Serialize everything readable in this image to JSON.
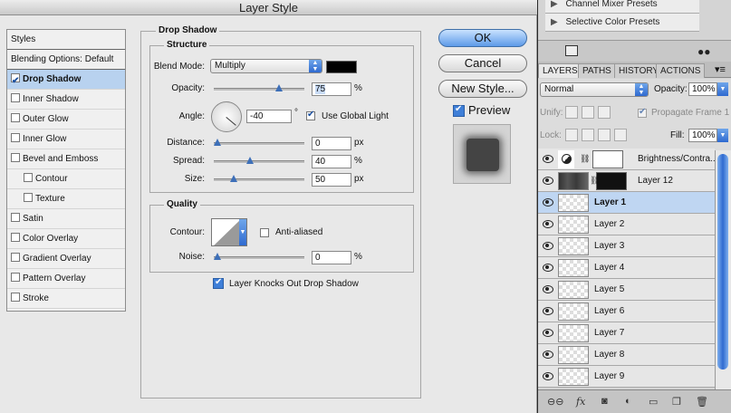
{
  "dialog": {
    "title": "Layer Style",
    "styles_list": [
      {
        "label": "Styles",
        "checkbox": false,
        "checked": false,
        "indent": false,
        "selected": false,
        "header": true
      },
      {
        "label": "Blending Options: Default",
        "checkbox": false,
        "checked": false,
        "indent": false,
        "selected": false,
        "header": true
      },
      {
        "label": "Drop Shadow",
        "checkbox": true,
        "checked": true,
        "indent": false,
        "selected": true
      },
      {
        "label": "Inner Shadow",
        "checkbox": true,
        "checked": false,
        "indent": false,
        "selected": false
      },
      {
        "label": "Outer Glow",
        "checkbox": true,
        "checked": false,
        "indent": false,
        "selected": false
      },
      {
        "label": "Inner Glow",
        "checkbox": true,
        "checked": false,
        "indent": false,
        "selected": false
      },
      {
        "label": "Bevel and Emboss",
        "checkbox": true,
        "checked": false,
        "indent": false,
        "selected": false
      },
      {
        "label": "Contour",
        "checkbox": true,
        "checked": false,
        "indent": true,
        "selected": false
      },
      {
        "label": "Texture",
        "checkbox": true,
        "checked": false,
        "indent": true,
        "selected": false
      },
      {
        "label": "Satin",
        "checkbox": true,
        "checked": false,
        "indent": false,
        "selected": false
      },
      {
        "label": "Color Overlay",
        "checkbox": true,
        "checked": false,
        "indent": false,
        "selected": false
      },
      {
        "label": "Gradient Overlay",
        "checkbox": true,
        "checked": false,
        "indent": false,
        "selected": false
      },
      {
        "label": "Pattern Overlay",
        "checkbox": true,
        "checked": false,
        "indent": false,
        "selected": false
      },
      {
        "label": "Stroke",
        "checkbox": true,
        "checked": false,
        "indent": false,
        "selected": false
      }
    ],
    "drop_shadow": {
      "title": "Drop Shadow",
      "structure_title": "Structure",
      "blend_mode_label": "Blend Mode:",
      "blend_mode_value": "Multiply",
      "shadow_color": "#000000",
      "opacity_label": "Opacity:",
      "opacity_value": "75",
      "opacity_fraction": 0.75,
      "opacity_unit": "%",
      "angle_label": "Angle:",
      "angle_value": "-40",
      "angle_unit": "°",
      "global_light_label": "Use Global Light",
      "global_light_checked": true,
      "distance_label": "Distance:",
      "distance_value": "0",
      "distance_fraction": 0,
      "distance_unit": "px",
      "spread_label": "Spread:",
      "spread_value": "40",
      "spread_fraction": 0.4,
      "spread_unit": "%",
      "size_label": "Size:",
      "size_value": "50",
      "size_fraction": 0.2,
      "size_unit": "px",
      "quality_title": "Quality",
      "contour_label": "Contour:",
      "anti_aliased_label": "Anti-aliased",
      "anti_aliased_checked": false,
      "noise_label": "Noise:",
      "noise_value": "0",
      "noise_fraction": 0,
      "noise_unit": "%",
      "knockout_label": "Layer Knocks Out Drop Shadow",
      "knockout_checked": true
    },
    "buttons": {
      "ok": "OK",
      "cancel": "Cancel",
      "new_style": "New Style...",
      "preview": "Preview",
      "preview_checked": true
    }
  },
  "right_panel": {
    "presets": [
      "Channel Mixer Presets",
      "Selective Color Presets"
    ],
    "tabs": [
      "LAYERS",
      "PATHS",
      "HISTORY",
      "ACTIONS"
    ],
    "blend_mode": "Normal",
    "opacity_label": "Opacity:",
    "opacity_value": "100%",
    "unify_label": "Unify:",
    "propagate_label": "Propagate Frame 1",
    "lock_label": "Lock:",
    "fill_label": "Fill:",
    "fill_value": "100%",
    "layers": [
      {
        "name": "Brightness/Contra...",
        "type": "adjustment",
        "selected": false
      },
      {
        "name": "Layer 12",
        "type": "image",
        "selected": false
      },
      {
        "name": "Layer 1",
        "type": "empty",
        "selected": true
      },
      {
        "name": "Layer 2",
        "type": "empty",
        "selected": false
      },
      {
        "name": "Layer 3",
        "type": "empty",
        "selected": false
      },
      {
        "name": "Layer 4",
        "type": "empty",
        "selected": false
      },
      {
        "name": "Layer 5",
        "type": "empty",
        "selected": false
      },
      {
        "name": "Layer 6",
        "type": "empty",
        "selected": false
      },
      {
        "name": "Layer 7",
        "type": "empty",
        "selected": false
      },
      {
        "name": "Layer 8",
        "type": "empty",
        "selected": false
      },
      {
        "name": "Layer 9",
        "type": "empty",
        "selected": false
      }
    ],
    "bottom_icons": [
      "link-icon",
      "fx-icon",
      "mask-icon",
      "adjustment-icon",
      "group-icon",
      "new-layer-icon",
      "trash-icon"
    ],
    "accent_color": "#3f7fd8"
  }
}
